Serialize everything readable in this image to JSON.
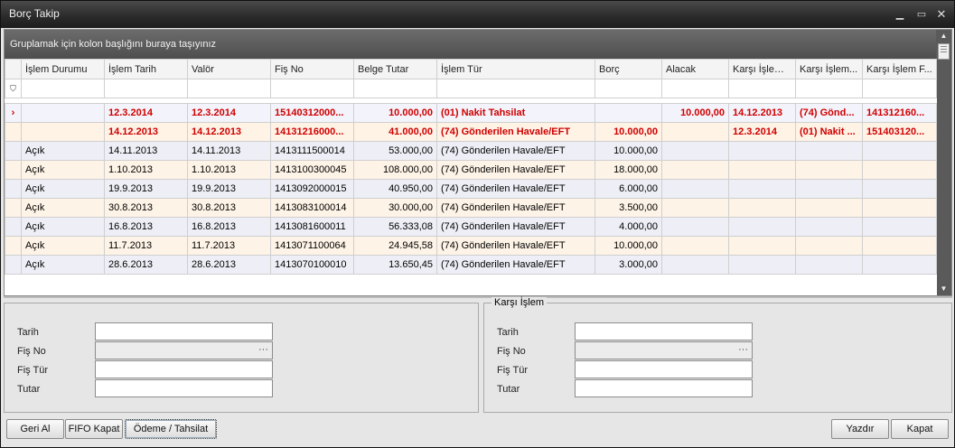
{
  "window": {
    "title": "Borç Takip"
  },
  "grid": {
    "group_panel_text": "Gruplamak için kolon başlığını buraya taşıyınız",
    "columns": [
      "İşlem Durumu",
      "İşlem Tarih",
      "Valör",
      "Fiş No",
      "Belge Tutar",
      "İşlem Tür",
      "Borç",
      "Alacak",
      "Karşı İşlem ...",
      "Karşı İşlem...",
      "Karşı İşlem F..."
    ],
    "rows": [
      {
        "durum": "",
        "tarih": "12.3.2014",
        "valor": "12.3.2014",
        "fisno": "15140312000...",
        "tutar": "10.000,00",
        "tur": "(01) Nakit Tahsilat",
        "borc": "",
        "alacak": "10.000,00",
        "k1": "14.12.2013",
        "k2": "(74) Gönd...",
        "k3": "141312160..."
      },
      {
        "durum": "",
        "tarih": "14.12.2013",
        "valor": "14.12.2013",
        "fisno": "14131216000...",
        "tutar": "41.000,00",
        "tur": "(74) Gönderilen Havale/EFT",
        "borc": "10.000,00",
        "alacak": "",
        "k1": "12.3.2014",
        "k2": "(01) Nakit ...",
        "k3": "151403120..."
      },
      {
        "durum": "Açık",
        "tarih": "14.11.2013",
        "valor": "14.11.2013",
        "fisno": "1413111500014",
        "tutar": "53.000,00",
        "tur": "(74) Gönderilen Havale/EFT",
        "borc": "10.000,00",
        "alacak": "",
        "k1": "",
        "k2": "",
        "k3": ""
      },
      {
        "durum": "Açık",
        "tarih": "1.10.2013",
        "valor": "1.10.2013",
        "fisno": "1413100300045",
        "tutar": "108.000,00",
        "tur": "(74) Gönderilen Havale/EFT",
        "borc": "18.000,00",
        "alacak": "",
        "k1": "",
        "k2": "",
        "k3": ""
      },
      {
        "durum": "Açık",
        "tarih": "19.9.2013",
        "valor": "19.9.2013",
        "fisno": "1413092000015",
        "tutar": "40.950,00",
        "tur": "(74) Gönderilen Havale/EFT",
        "borc": "6.000,00",
        "alacak": "",
        "k1": "",
        "k2": "",
        "k3": ""
      },
      {
        "durum": "Açık",
        "tarih": "30.8.2013",
        "valor": "30.8.2013",
        "fisno": "1413083100014",
        "tutar": "30.000,00",
        "tur": "(74) Gönderilen Havale/EFT",
        "borc": "3.500,00",
        "alacak": "",
        "k1": "",
        "k2": "",
        "k3": ""
      },
      {
        "durum": "Açık",
        "tarih": "16.8.2013",
        "valor": "16.8.2013",
        "fisno": "1413081600011",
        "tutar": "56.333,08",
        "tur": "(74) Gönderilen Havale/EFT",
        "borc": "4.000,00",
        "alacak": "",
        "k1": "",
        "k2": "",
        "k3": ""
      },
      {
        "durum": "Açık",
        "tarih": "11.7.2013",
        "valor": "11.7.2013",
        "fisno": "1413071100064",
        "tutar": "24.945,58",
        "tur": "(74) Gönderilen Havale/EFT",
        "borc": "10.000,00",
        "alacak": "",
        "k1": "",
        "k2": "",
        "k3": ""
      },
      {
        "durum": "Açık",
        "tarih": "28.6.2013",
        "valor": "28.6.2013",
        "fisno": "1413070100010",
        "tutar": "13.650,45",
        "tur": "(74) Gönderilen Havale/EFT",
        "borc": "3.000,00",
        "alacak": "",
        "k1": "",
        "k2": "",
        "k3": ""
      }
    ]
  },
  "left_panel": {
    "labels": [
      "Tarih",
      "Fiş No",
      "Fiş Tür",
      "Tutar"
    ],
    "dots": "···"
  },
  "right_panel": {
    "legend": "Karşı İşlem",
    "labels": [
      "Tarih",
      "Fiş No",
      "Fiş Tür",
      "Tutar"
    ],
    "dots": "···"
  },
  "buttons": {
    "geri_al": "Geri Al",
    "fifo": "FIFO Kapat",
    "odeme": "Ödeme / Tahsilat",
    "yazdir": "Yazdır",
    "kapat": "Kapat"
  }
}
